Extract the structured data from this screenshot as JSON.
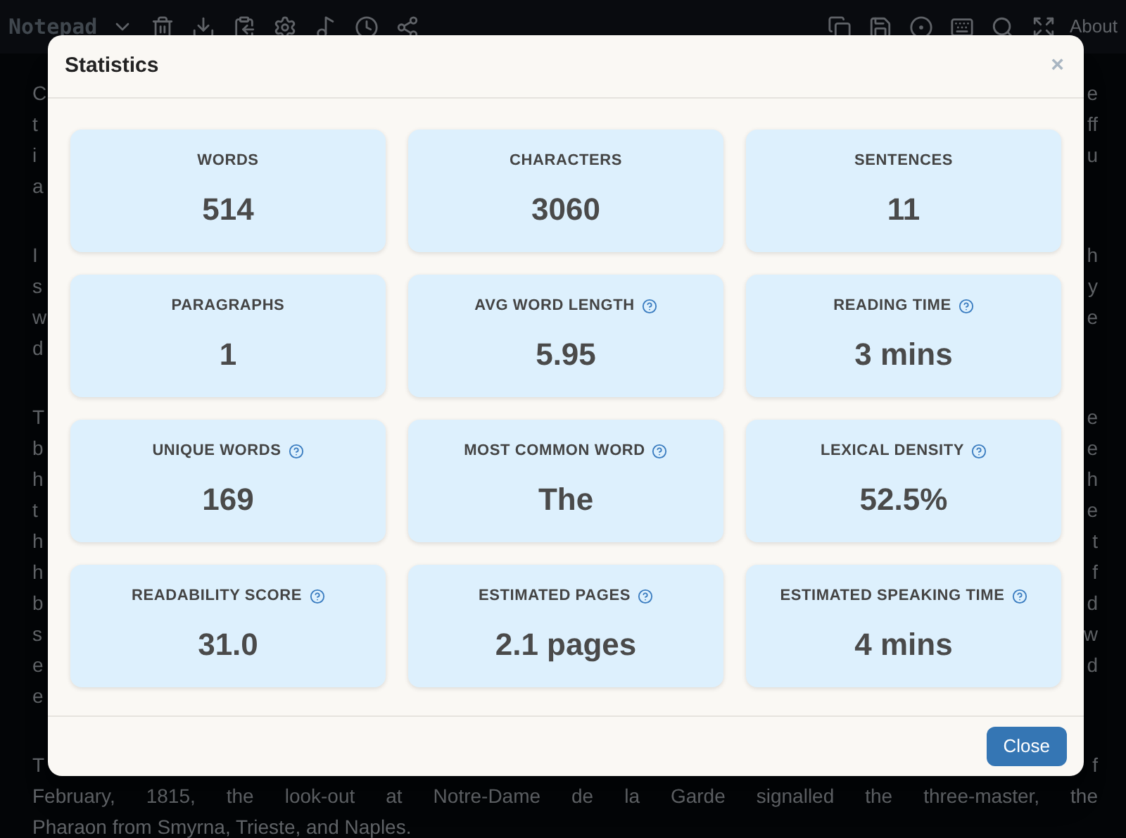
{
  "toolbar": {
    "app_name": "Notepad",
    "about": "About"
  },
  "editor": {
    "paragraphs": [
      {
        "lines": [
          {
            "kind": "clipped",
            "left": "C",
            "right": "e"
          },
          {
            "kind": "clipped",
            "left": "t",
            "right": "ff"
          },
          {
            "kind": "clipped",
            "left": "i",
            "right": "u"
          },
          {
            "kind": "clipped",
            "left": "a"
          }
        ]
      },
      {
        "lines": [
          {
            "kind": "clipped",
            "left": "I",
            "right": "h"
          },
          {
            "kind": "clipped",
            "left": "s",
            "right": "y"
          },
          {
            "kind": "clipped",
            "left": "w",
            "right": "e"
          },
          {
            "kind": "clipped",
            "left": "d"
          }
        ]
      },
      {
        "lines": [
          {
            "kind": "clipped",
            "left": "T",
            "right": "e"
          },
          {
            "kind": "clipped",
            "left": "b",
            "right": "e"
          },
          {
            "kind": "clipped",
            "left": "h",
            "right": "h"
          },
          {
            "kind": "clipped",
            "left": "t",
            "right": "e"
          },
          {
            "kind": "clipped",
            "left": "h",
            "right": "t"
          },
          {
            "kind": "clipped",
            "left": "h",
            "right": "f"
          },
          {
            "kind": "clipped",
            "left": "b",
            "right": "d"
          },
          {
            "kind": "clipped",
            "left": "s",
            "right": "w"
          },
          {
            "kind": "clipped",
            "left": "e",
            "right": "d"
          },
          {
            "kind": "clipped",
            "left": "e"
          }
        ]
      },
      {
        "lines": [
          {
            "kind": "clipped",
            "left": "T",
            "right": "f"
          },
          {
            "kind": "full",
            "text": "February, 1815, the look-out at Notre-Dame de la Garde signalled the three-master, the",
            "justified": true
          },
          {
            "kind": "full",
            "text": "Pharaon from Smyrna, Trieste, and Naples.",
            "justified": false
          }
        ]
      }
    ]
  },
  "dialog": {
    "title": "Statistics",
    "close_symbol": "×",
    "button": "Close",
    "stats": [
      {
        "label": "WORDS",
        "value": "514",
        "info": false
      },
      {
        "label": "CHARACTERS",
        "value": "3060",
        "info": false
      },
      {
        "label": "SENTENCES",
        "value": "11",
        "info": false
      },
      {
        "label": "PARAGRAPHS",
        "value": "1",
        "info": false
      },
      {
        "label": "AVG WORD LENGTH",
        "value": "5.95",
        "info": true
      },
      {
        "label": "READING TIME",
        "value": "3 mins",
        "info": true
      },
      {
        "label": "UNIQUE WORDS",
        "value": "169",
        "info": true
      },
      {
        "label": "MOST COMMON WORD",
        "value": "The",
        "info": true
      },
      {
        "label": "LEXICAL DENSITY",
        "value": "52.5%",
        "info": true
      },
      {
        "label": "READABILITY SCORE",
        "value": "31.0",
        "info": true
      },
      {
        "label": "ESTIMATED PAGES",
        "value": "2.1 pages",
        "info": true
      },
      {
        "label": "ESTIMATED SPEAKING TIME",
        "value": "4 mins",
        "info": true
      }
    ]
  }
}
